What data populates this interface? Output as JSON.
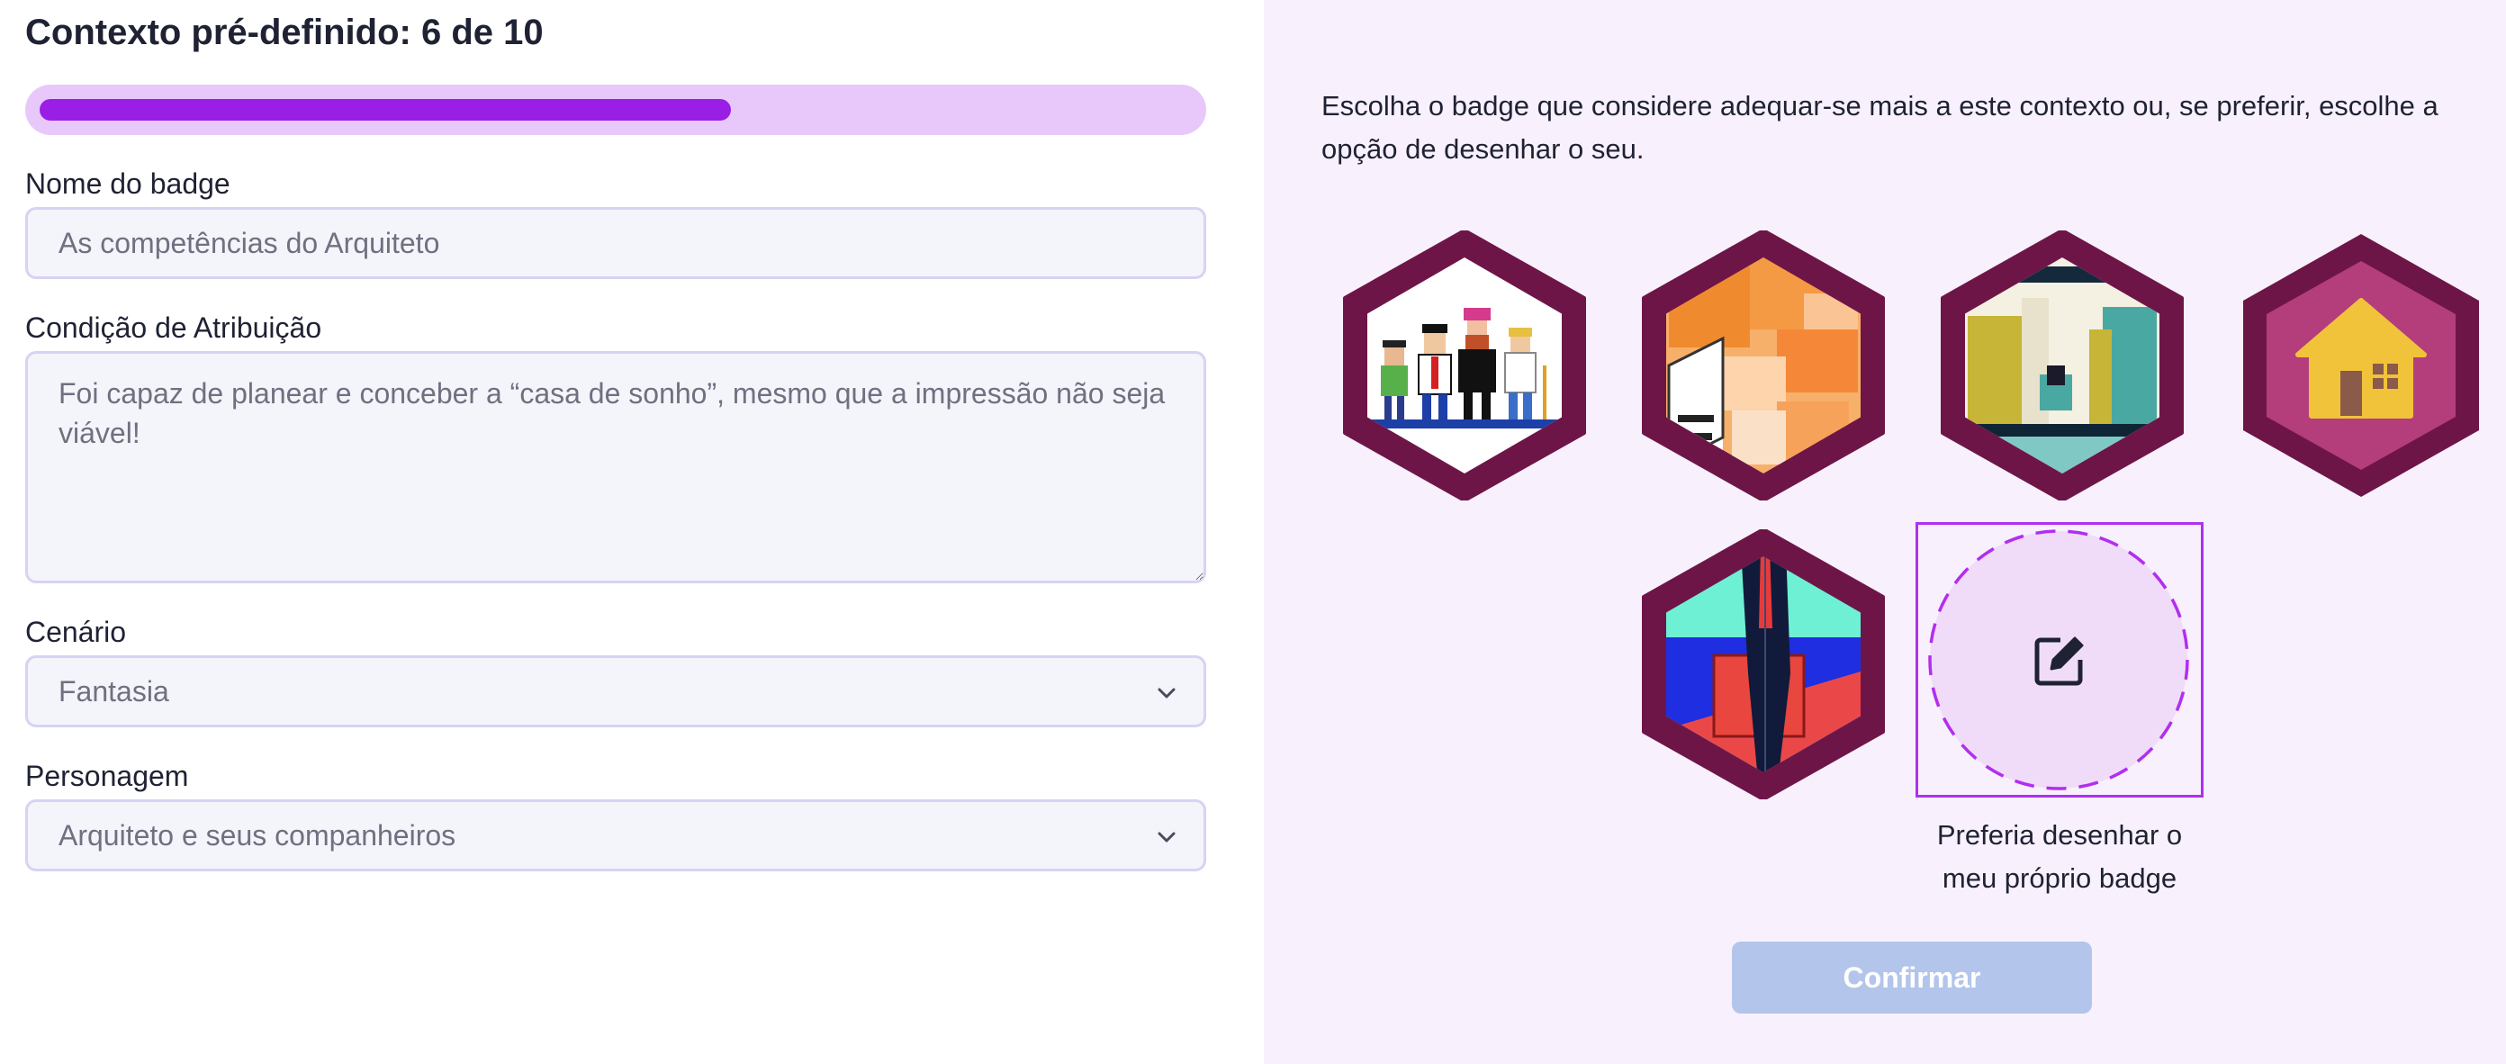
{
  "form": {
    "title": "Contexto pré-definido: 6 de 10",
    "progress": {
      "current": 6,
      "total": 10,
      "fraction": 0.6
    },
    "badge_name": {
      "label": "Nome do badge",
      "placeholder": "As competências do Arquiteto"
    },
    "condition": {
      "label": "Condição de Atribuição",
      "placeholder": "Foi capaz de planear e conceber a “casa de sonho”, mesmo que a impressão não seja viável!"
    },
    "scenario": {
      "label": "Cenário",
      "value": "Fantasia"
    },
    "character": {
      "label": "Personagem",
      "value": "Arquiteto e seus companheiros"
    }
  },
  "badges": {
    "intro": "Escolha o badge que considere adequar-se mais a este contexto ou, se preferir, escolhe a opção de desenhar o seu.",
    "options": [
      {
        "name": "pixel-characters",
        "color": "#6e1548"
      },
      {
        "name": "orange-cubes",
        "color": "#6e1548"
      },
      {
        "name": "shopping-street",
        "color": "#6e1548"
      },
      {
        "name": "yellow-house",
        "color": "#6e1548"
      },
      {
        "name": "businessman-briefcase",
        "color": "#6e1548"
      }
    ],
    "draw_own": {
      "label": "Preferia desenhar o meu próprio badge",
      "icon": "edit-icon"
    },
    "confirm_label": "Confirmar"
  },
  "colors": {
    "accent": "#9a1fe6",
    "progress_track": "#e8c8fb",
    "badge_frame": "#6e1548",
    "confirm_disabled": "#b3c5ea",
    "right_bg": "#f8f1fd"
  }
}
